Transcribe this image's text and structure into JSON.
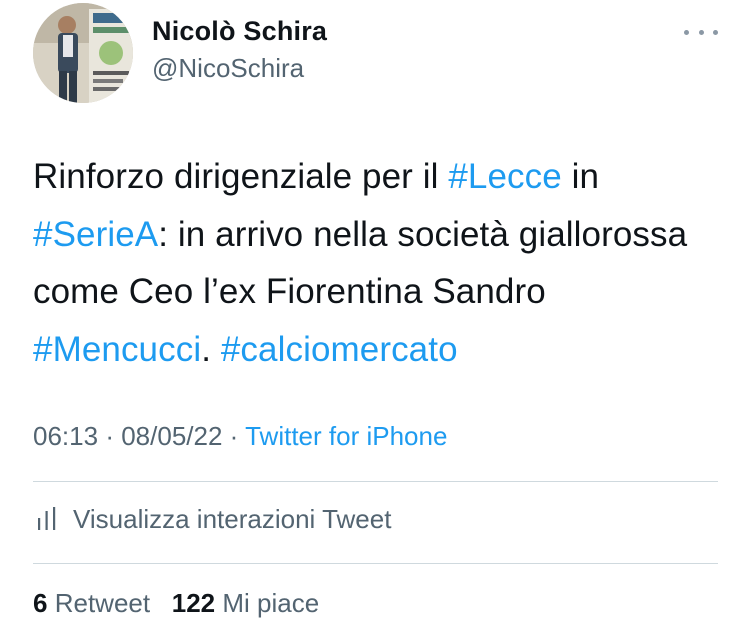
{
  "author": {
    "display_name": "Nicolò Schira",
    "handle": "@NicoSchira"
  },
  "tweet": {
    "segments": [
      {
        "text": "Rinforzo dirigenziale per il ",
        "hashtag": false
      },
      {
        "text": "#Lecce",
        "hashtag": true
      },
      {
        "text": " in ",
        "hashtag": false
      },
      {
        "text": "#SerieA",
        "hashtag": true
      },
      {
        "text": ": in arrivo nella società giallorossa come Ceo l’ex Fiorentina Sandro ",
        "hashtag": false
      },
      {
        "text": "#Mencucci",
        "hashtag": true
      },
      {
        "text": ". ",
        "hashtag": false
      },
      {
        "text": "#calciomercato",
        "hashtag": true
      }
    ]
  },
  "meta": {
    "time": "06:13",
    "separator": "·",
    "date": "08/05/22",
    "source": "Twitter for iPhone"
  },
  "analytics": {
    "icon": "analytics-bars-icon",
    "label": "Visualizza interazioni Tweet"
  },
  "stats": {
    "retweets_count": "6",
    "retweets_label": "Retweet",
    "likes_count": "122",
    "likes_label": "Mi piace"
  },
  "colors": {
    "link": "#1d9bf0",
    "secondary_text": "#536471",
    "primary_text": "#0f1419",
    "divider": "#cfd9de"
  }
}
